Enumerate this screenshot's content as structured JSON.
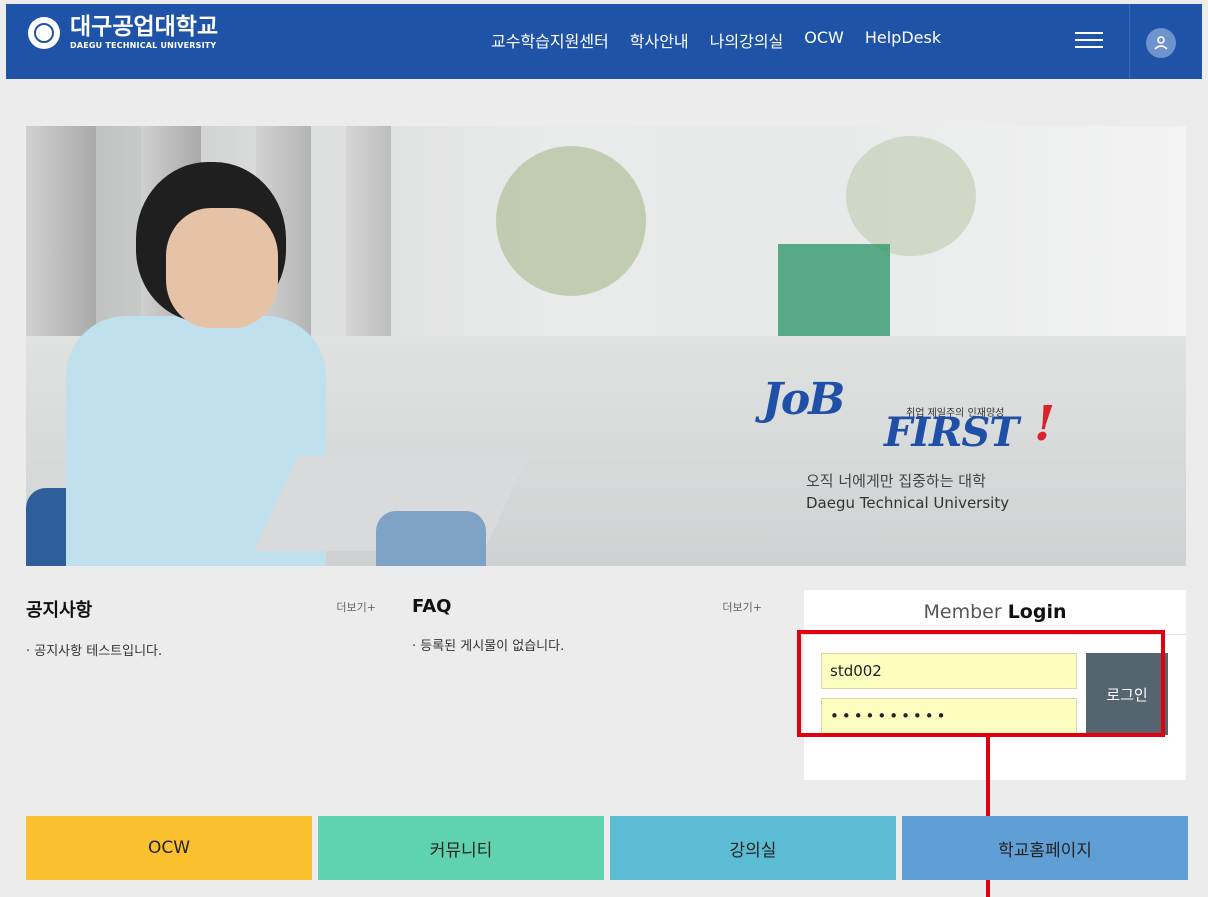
{
  "header": {
    "logo_kr": "대구공업대학교",
    "logo_en": "DAEGU TECHNICAL UNIVERSITY",
    "menu": [
      "교수학습지원센터",
      "학사안내",
      "나의강의실",
      "OCW",
      "HelpDesk"
    ],
    "icons": [
      "hamburger-icon",
      "user-icon"
    ]
  },
  "hero": {
    "job": "JoB",
    "first": "FIRST",
    "bang": "!",
    "tagline": "취업 제일주의 인재양성",
    "line1": "오직 너에게만 집중하는 대학",
    "line2": "Daegu Technical University"
  },
  "notice": {
    "title": "공지사항",
    "more": "더보기+",
    "items": [
      "· 공지사항 테스트입니다."
    ]
  },
  "faq": {
    "title": "FAQ",
    "more": "더보기+",
    "items": [
      "· 등록된 게시물이 없습니다."
    ]
  },
  "login": {
    "title_prefix": "Member",
    "title_bold": "Login",
    "id_value": "std002",
    "password_masked": "••••••••••",
    "button": "로그인"
  },
  "tiles": [
    {
      "label": "OCW",
      "color": "#fbc02d"
    },
    {
      "label": "커뮤니티",
      "color": "#5fd3b0"
    },
    {
      "label": "강의실",
      "color": "#5bbcd4"
    },
    {
      "label": "학교홈페이지",
      "color": "#5f9fd6"
    }
  ],
  "colors": {
    "nav": "#1f53a8",
    "highlight": "#e0000f",
    "login_button": "#556570",
    "input_bg": "#fdfdc0"
  }
}
